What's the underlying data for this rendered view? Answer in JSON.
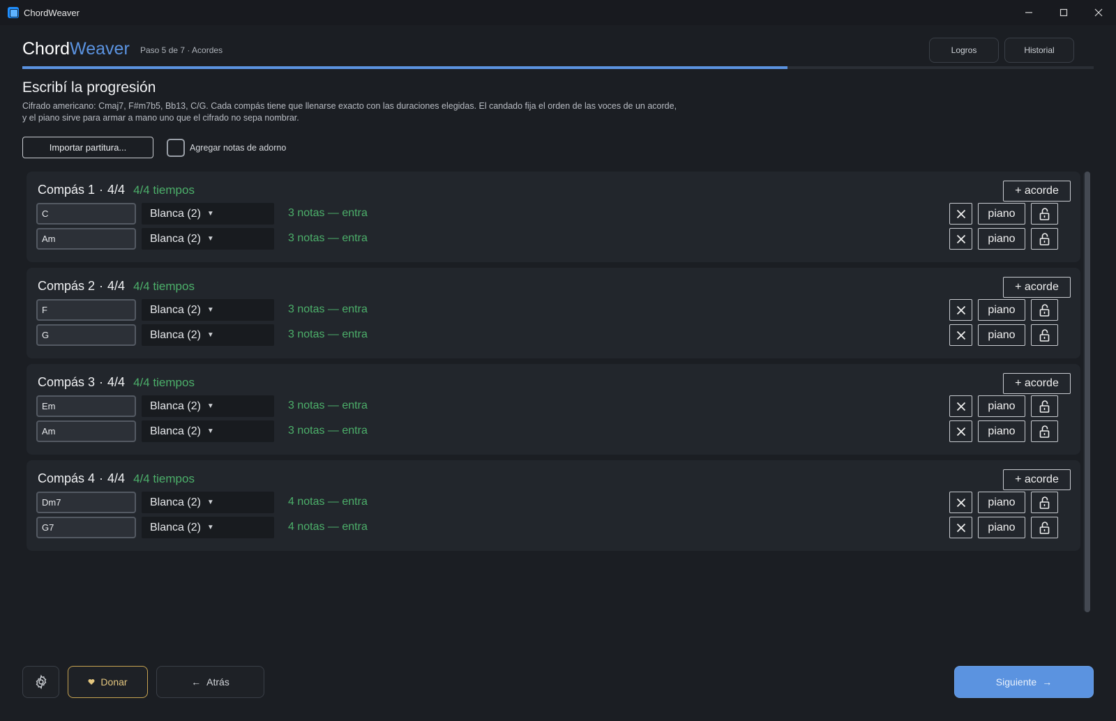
{
  "window": {
    "title": "ChordWeaver",
    "controls": [
      "minimize-icon",
      "maximize-icon",
      "close-icon"
    ]
  },
  "header": {
    "brand_part1": "Chord",
    "brand_part2": "Weaver",
    "step": "Paso 5 de 7 · Acordes",
    "achievements_label": "Logros",
    "history_label": "Historial",
    "progress_fraction": 0.714
  },
  "main": {
    "title": "Escribí la progresión",
    "description_line1": "Cifrado americano: Cmaj7, F#m7b5, Bb13, C/G. Cada compás tiene que llenarse exacto con las duraciones elegidas. El candado fija el orden de las voces de un acorde,",
    "description_line2": "y el piano sirve para armar a mano uno que el cifrado no sepa nombrar.",
    "import_label": "Importar partitura...",
    "ornament_label": "Agregar notas de adorno",
    "ornament_checked": false
  },
  "bars": [
    {
      "label": "Compás 1",
      "time_signature": "4/4",
      "beats": "4/4 tiempos",
      "add_label": "+ acorde",
      "chords": [
        {
          "symbol": "C",
          "duration": "Blanca (2)",
          "status": "3 notas — entra"
        },
        {
          "symbol": "Am",
          "duration": "Blanca (2)",
          "status": "3 notas — entra"
        }
      ]
    },
    {
      "label": "Compás 2",
      "time_signature": "4/4",
      "beats": "4/4 tiempos",
      "add_label": "+ acorde",
      "chords": [
        {
          "symbol": "F",
          "duration": "Blanca (2)",
          "status": "3 notas — entra"
        },
        {
          "symbol": "G",
          "duration": "Blanca (2)",
          "status": "3 notas — entra"
        }
      ]
    },
    {
      "label": "Compás 3",
      "time_signature": "4/4",
      "beats": "4/4 tiempos",
      "add_label": "+ acorde",
      "chords": [
        {
          "symbol": "Em",
          "duration": "Blanca (2)",
          "status": "3 notas — entra"
        },
        {
          "symbol": "Am",
          "duration": "Blanca (2)",
          "status": "3 notas — entra"
        }
      ]
    },
    {
      "label": "Compás 4",
      "time_signature": "4/4",
      "beats": "4/4 tiempos",
      "add_label": "+ acorde",
      "chords": [
        {
          "symbol": "Dm7",
          "duration": "Blanca (2)",
          "status": "4 notas — entra"
        },
        {
          "symbol": "G7",
          "duration": "Blanca (2)",
          "status": "4 notas — entra"
        }
      ]
    }
  ],
  "row_actions": {
    "remove_icon": "close-icon",
    "piano_label": "piano",
    "lock_icon": "unlock-icon"
  },
  "footer": {
    "settings_icon": "gear-icon",
    "donate_label": "Donar",
    "donate_icon": "heart-icon",
    "back_label": "Atrás",
    "back_arrow": "←",
    "next_label": "Siguiente",
    "next_arrow": "→"
  },
  "colors": {
    "accent": "#5b93e0",
    "success": "#4caf6a",
    "donate": "#c8a451",
    "background": "#1b1e23",
    "card": "#22262c"
  }
}
